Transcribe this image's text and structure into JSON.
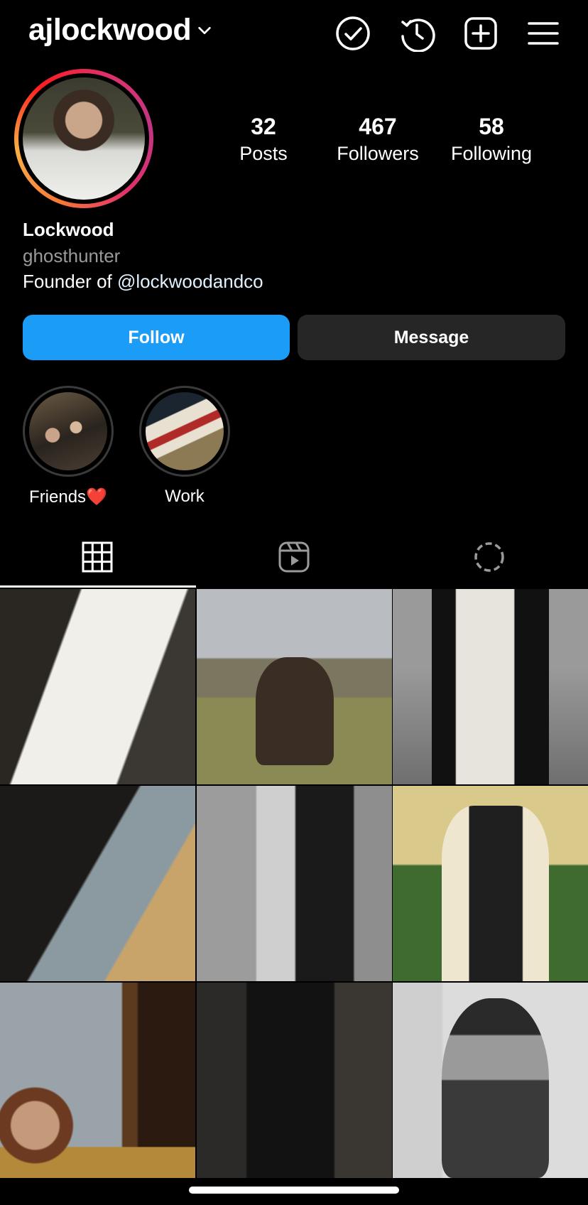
{
  "header": {
    "username": "ajlockwood",
    "icons": [
      "verified-check-icon",
      "history-icon",
      "new-post-icon",
      "menu-icon"
    ]
  },
  "profile": {
    "stats": [
      {
        "value": "32",
        "label": "Posts"
      },
      {
        "value": "467",
        "label": "Followers"
      },
      {
        "value": "58",
        "label": "Following"
      }
    ],
    "name": "Lockwood",
    "category": "ghosthunter",
    "bio_prefix": "Founder of ",
    "bio_mention": "@lockwoodandco"
  },
  "actions": {
    "follow_label": "Follow",
    "message_label": "Message"
  },
  "highlights": [
    {
      "label": "Friends❤️"
    },
    {
      "label": "Work"
    }
  ],
  "tabs": [
    "grid-icon",
    "reels-icon",
    "tagged-icon"
  ],
  "grid": {
    "post_count_visible": 9
  },
  "colors": {
    "accent": "#1a9cf7",
    "background": "#000000",
    "secondary_button": "#262626"
  }
}
